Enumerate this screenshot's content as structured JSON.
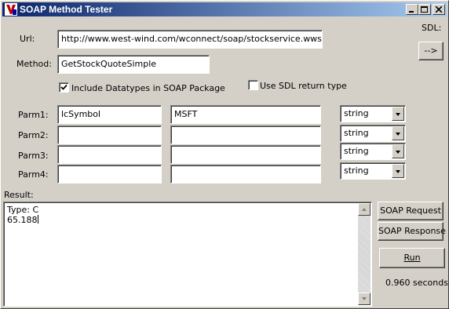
{
  "window": {
    "title": "SOAP Method Tester",
    "icon": "fox-app-icon"
  },
  "form": {
    "url_label": "Url:",
    "url_value": "http://www.west-wind.com/wconnect/soap/stockservice.wwsoap",
    "sdl_label": "SDL:",
    "sdl_button": "-->",
    "method_label": "Method:",
    "method_value": "GetStockQuoteSimple",
    "include_datatypes_label": "Include Datatypes in SOAP Package",
    "include_datatypes_checked": true,
    "use_sdl_label": "Use SDL return type",
    "use_sdl_checked": false
  },
  "params": [
    {
      "label": "Parm1:",
      "name": "lcSymbol",
      "value": "MSFT",
      "type": "string"
    },
    {
      "label": "Parm2:",
      "name": "",
      "value": "",
      "type": "string"
    },
    {
      "label": "Parm3:",
      "name": "",
      "value": "",
      "type": "string"
    },
    {
      "label": "Parm4:",
      "name": "",
      "value": "",
      "type": "string"
    }
  ],
  "result": {
    "label": "Result:",
    "lines": [
      "Type: C",
      "65.188"
    ]
  },
  "actions": {
    "soap_request": "SOAP Request",
    "soap_response": "SOAP Response",
    "run": "Run",
    "elapsed": "0.960 seconds"
  }
}
